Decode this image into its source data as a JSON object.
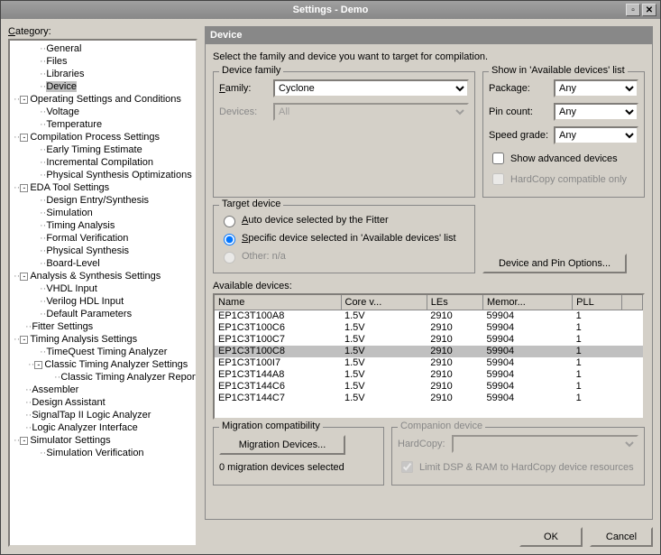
{
  "window": {
    "title": "Settings - Demo"
  },
  "category_label": "Category:",
  "tree": [
    {
      "label": "General",
      "indent": 1
    },
    {
      "label": "Files",
      "indent": 1
    },
    {
      "label": "Libraries",
      "indent": 1
    },
    {
      "label": "Device",
      "indent": 1,
      "selected": true
    },
    {
      "label": "Operating Settings and Conditions",
      "indent": 0,
      "toggle": "-"
    },
    {
      "label": "Voltage",
      "indent": 1
    },
    {
      "label": "Temperature",
      "indent": 1
    },
    {
      "label": "Compilation Process Settings",
      "indent": 0,
      "toggle": "-"
    },
    {
      "label": "Early Timing Estimate",
      "indent": 1
    },
    {
      "label": "Incremental Compilation",
      "indent": 1
    },
    {
      "label": "Physical Synthesis Optimizations",
      "indent": 1
    },
    {
      "label": "EDA Tool Settings",
      "indent": 0,
      "toggle": "-"
    },
    {
      "label": "Design Entry/Synthesis",
      "indent": 1
    },
    {
      "label": "Simulation",
      "indent": 1
    },
    {
      "label": "Timing Analysis",
      "indent": 1
    },
    {
      "label": "Formal Verification",
      "indent": 1
    },
    {
      "label": "Physical Synthesis",
      "indent": 1
    },
    {
      "label": "Board-Level",
      "indent": 1
    },
    {
      "label": "Analysis & Synthesis Settings",
      "indent": 0,
      "toggle": "-"
    },
    {
      "label": "VHDL Input",
      "indent": 1
    },
    {
      "label": "Verilog HDL Input",
      "indent": 1
    },
    {
      "label": "Default Parameters",
      "indent": 1
    },
    {
      "label": "Fitter Settings",
      "indent": 0
    },
    {
      "label": "Timing Analysis Settings",
      "indent": 0,
      "toggle": "-"
    },
    {
      "label": "TimeQuest Timing Analyzer",
      "indent": 1
    },
    {
      "label": "Classic Timing Analyzer Settings",
      "indent": 1,
      "toggle": "-"
    },
    {
      "label": "Classic Timing Analyzer Reporting",
      "indent": 2
    },
    {
      "label": "Assembler",
      "indent": 0
    },
    {
      "label": "Design Assistant",
      "indent": 0
    },
    {
      "label": "SignalTap II Logic Analyzer",
      "indent": 0
    },
    {
      "label": "Logic Analyzer Interface",
      "indent": 0
    },
    {
      "label": "Simulator Settings",
      "indent": 0,
      "toggle": "-"
    },
    {
      "label": "Simulation Verification",
      "indent": 1
    }
  ],
  "panel": {
    "title": "Device",
    "intro": "Select the family and device you want to target for compilation.",
    "device_family_group": "Device family",
    "family_label": "Family:",
    "family_value": "Cyclone",
    "devices_label": "Devices:",
    "devices_value": "All",
    "show_group": "Show in 'Available devices' list",
    "package_label": "Package:",
    "package_value": "Any",
    "pin_label": "Pin count:",
    "pin_value": "Any",
    "speed_label": "Speed grade:",
    "speed_value": "Any",
    "show_advanced": "Show advanced devices",
    "hardcopy_compat": "HardCopy compatible only",
    "target_group": "Target device",
    "target_auto": "Auto device selected by the Fitter",
    "target_specific": "Specific device selected in 'Available devices' list",
    "target_other": "Other:  n/a",
    "device_pin_btn": "Device and Pin Options...",
    "available_label": "Available devices:",
    "columns": [
      "Name",
      "Core v...",
      "LEs",
      "Memor...",
      "PLL"
    ],
    "rows": [
      {
        "name": "EP1C3T100A8",
        "core": "1.5V",
        "les": "2910",
        "mem": "59904",
        "pll": "1"
      },
      {
        "name": "EP1C3T100C6",
        "core": "1.5V",
        "les": "2910",
        "mem": "59904",
        "pll": "1"
      },
      {
        "name": "EP1C3T100C7",
        "core": "1.5V",
        "les": "2910",
        "mem": "59904",
        "pll": "1"
      },
      {
        "name": "EP1C3T100C8",
        "core": "1.5V",
        "les": "2910",
        "mem": "59904",
        "pll": "1",
        "selected": true
      },
      {
        "name": "EP1C3T100I7",
        "core": "1.5V",
        "les": "2910",
        "mem": "59904",
        "pll": "1"
      },
      {
        "name": "EP1C3T144A8",
        "core": "1.5V",
        "les": "2910",
        "mem": "59904",
        "pll": "1"
      },
      {
        "name": "EP1C3T144C6",
        "core": "1.5V",
        "les": "2910",
        "mem": "59904",
        "pll": "1"
      },
      {
        "name": "EP1C3T144C7",
        "core": "1.5V",
        "les": "2910",
        "mem": "59904",
        "pll": "1"
      }
    ],
    "migration_group": "Migration compatibility",
    "migration_btn": "Migration Devices...",
    "migration_status": "0 migration devices selected",
    "companion_group": "Companion device",
    "hardcopy_label": "HardCopy:",
    "limit_dsp": "Limit DSP & RAM to HardCopy device resources"
  },
  "buttons": {
    "ok": "OK",
    "cancel": "Cancel"
  }
}
